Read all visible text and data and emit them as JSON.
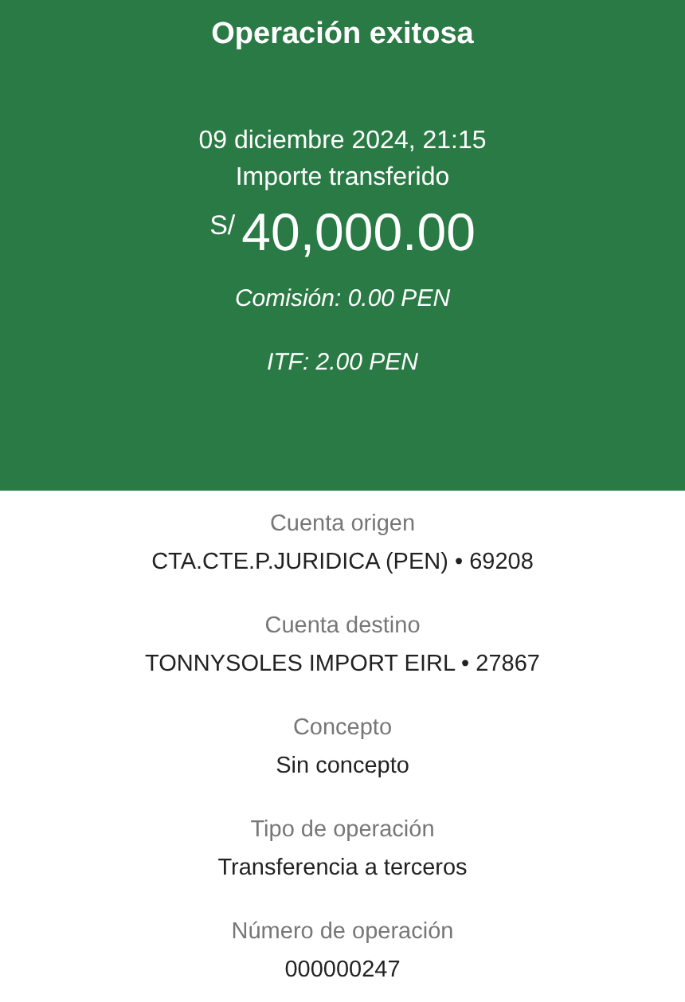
{
  "header": {
    "title": "Operación exitosa",
    "date": "09 diciembre 2024, 21:15",
    "amount_label": "Importe transferido",
    "currency": "S/",
    "amount": "40,000.00",
    "commission": "Comisión: 0.00 PEN",
    "itf": "ITF: 2.00 PEN"
  },
  "details": [
    {
      "label": "Cuenta origen",
      "value": "CTA.CTE.P.JURIDICA (PEN) • 69208"
    },
    {
      "label": "Cuenta destino",
      "value": "TONNYSOLES IMPORT EIRL • 27867"
    },
    {
      "label": "Concepto",
      "value": "Sin concepto"
    },
    {
      "label": "Tipo de operación",
      "value": "Transferencia a terceros"
    },
    {
      "label": "Número de operación",
      "value": "000000247"
    }
  ]
}
